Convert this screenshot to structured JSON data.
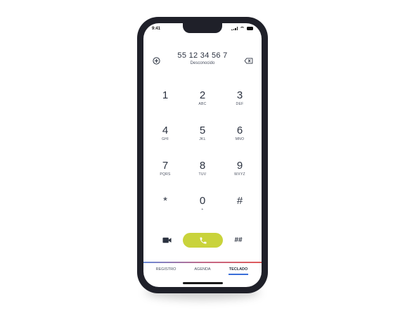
{
  "status": {
    "time": "9:41"
  },
  "dialer": {
    "number": "55 12 34 56 7",
    "caller_label": "Desconocido",
    "keys": [
      {
        "digit": "1",
        "letters": ""
      },
      {
        "digit": "2",
        "letters": "ABC"
      },
      {
        "digit": "3",
        "letters": "DEF"
      },
      {
        "digit": "4",
        "letters": "GHI"
      },
      {
        "digit": "5",
        "letters": "JKL"
      },
      {
        "digit": "6",
        "letters": "MNO"
      },
      {
        "digit": "7",
        "letters": "PQRS"
      },
      {
        "digit": "8",
        "letters": "TUV"
      },
      {
        "digit": "9",
        "letters": "WXYZ"
      },
      {
        "digit": "*",
        "letters": ""
      },
      {
        "digit": "0",
        "letters": "+"
      },
      {
        "digit": "#",
        "letters": ""
      }
    ],
    "hash_hash_label": "##"
  },
  "tabs": [
    {
      "label": "REGISTRO",
      "active": false
    },
    {
      "label": "AGENDA",
      "active": false
    },
    {
      "label": "TECLADO",
      "active": true
    }
  ],
  "colors": {
    "call_button": "#c9d33b",
    "phone_frame": "#1f2029",
    "active_tab_underline": "#3a6fd8",
    "text": "#2b3240"
  },
  "icons": {
    "add_contact": "plus-circle-icon",
    "backspace": "backspace-icon",
    "video": "video-camera-icon",
    "call": "phone-icon"
  }
}
